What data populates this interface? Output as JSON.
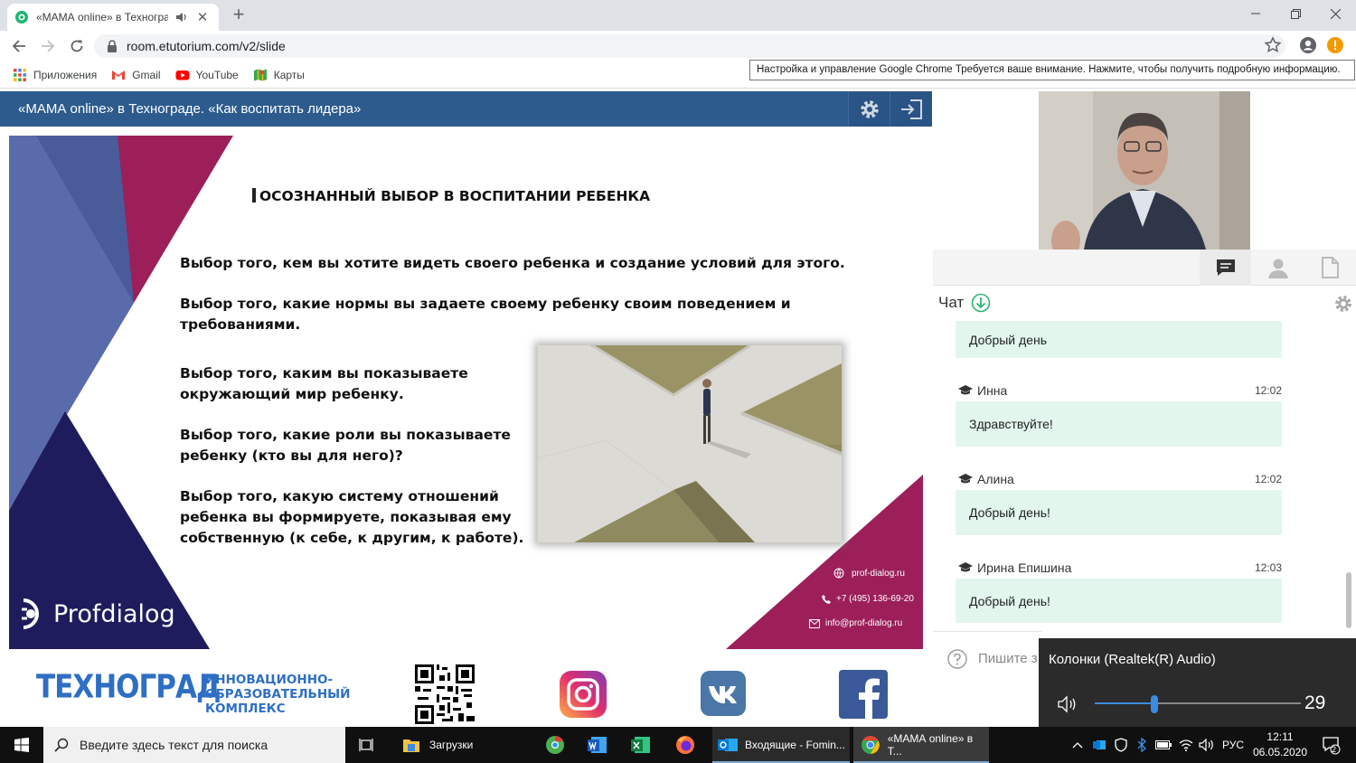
{
  "browser": {
    "tab_title": "«МАМА online» в Техноград",
    "new_tab": "+",
    "url": "room.etutorium.com/v2/slide",
    "bookmarks": [
      {
        "label": "Приложения",
        "icon": "apps-grid-icon"
      },
      {
        "label": "Gmail",
        "icon": "gmail-icon"
      },
      {
        "label": "YouTube",
        "icon": "youtube-icon"
      },
      {
        "label": "Карты",
        "icon": "maps-icon"
      }
    ],
    "tooltip": "Настройка и управление Google Chrome Требуется ваше внимание. Нажмите, чтобы получить подробную информацию."
  },
  "app": {
    "title": "«МАМА online» в Технограде. «Как воспитать лидера»"
  },
  "slide": {
    "heading": "ОСОЗНАННЫЙ ВЫБОР В ВОСПИТАНИИ РЕБЕНКА",
    "para1": "Выбор того, кем вы хотите видеть своего ребенка и создание условий для этого.",
    "para2_l1": "Выбор того, какие нормы вы задаете своему ребенку своим поведением и",
    "para2_l2": "требованиями.",
    "para3_l1": "Выбор того, каким вы показываете",
    "para3_l2": "окружающий мир ребенку.",
    "para4_l1": "Выбор того, какие роли вы показываете",
    "para4_l2": "ребенку (кто вы для него)?",
    "para5_l1": "Выбор того, какую систему отношений",
    "para5_l2": "ребенка вы формируете, показывая ему",
    "para5_l3": "собственную (к себе, к другим, к работе).",
    "logo": "Profdialog",
    "contact_site": "prof-dialog.ru",
    "contact_phone": "+7 (495) 136-69-20",
    "contact_email": "info@prof-dialog.ru"
  },
  "strip": {
    "brand": "ТЕХНОГРАД",
    "tagline_l1": "ИННОВАЦИОННО-",
    "tagline_l2": "ОБРАЗОВАТЕЛЬНЫЙ",
    "tagline_l3": "КОМПЛЕКС"
  },
  "chat": {
    "title": "Чат",
    "messages": [
      {
        "name": "",
        "time": "",
        "text": "Добрый день"
      },
      {
        "name": "Инна",
        "time": "12:02",
        "text": "Здравствуйте!"
      },
      {
        "name": "Алина",
        "time": "12:02",
        "text": "Добрый день!"
      },
      {
        "name": "Ирина Епишина",
        "time": "12:03",
        "text": "Добрый день!"
      }
    ],
    "input_placeholder": "Пишите з"
  },
  "volume": {
    "device": "Колонки (Realtek(R) Audio)",
    "level": "29",
    "level_value": 29
  },
  "taskbar": {
    "search_placeholder": "Введите здесь текст для поиска",
    "apps": [
      {
        "label": "Загрузки"
      },
      {
        "label": "Входящие - Fomin..."
      },
      {
        "label": "«МАМА online» в Т..."
      }
    ],
    "lang": "РУС",
    "time": "12:11",
    "date": "06.05.2020",
    "notif_count": "2"
  },
  "colors": {
    "header": "#2d5b8e",
    "magenta": "#9c1f5a",
    "navy": "#1f1c5e",
    "slate": "#4a5b9a",
    "bubble": "#e2f6ee",
    "technograd_blue": "#2e6fc4"
  }
}
